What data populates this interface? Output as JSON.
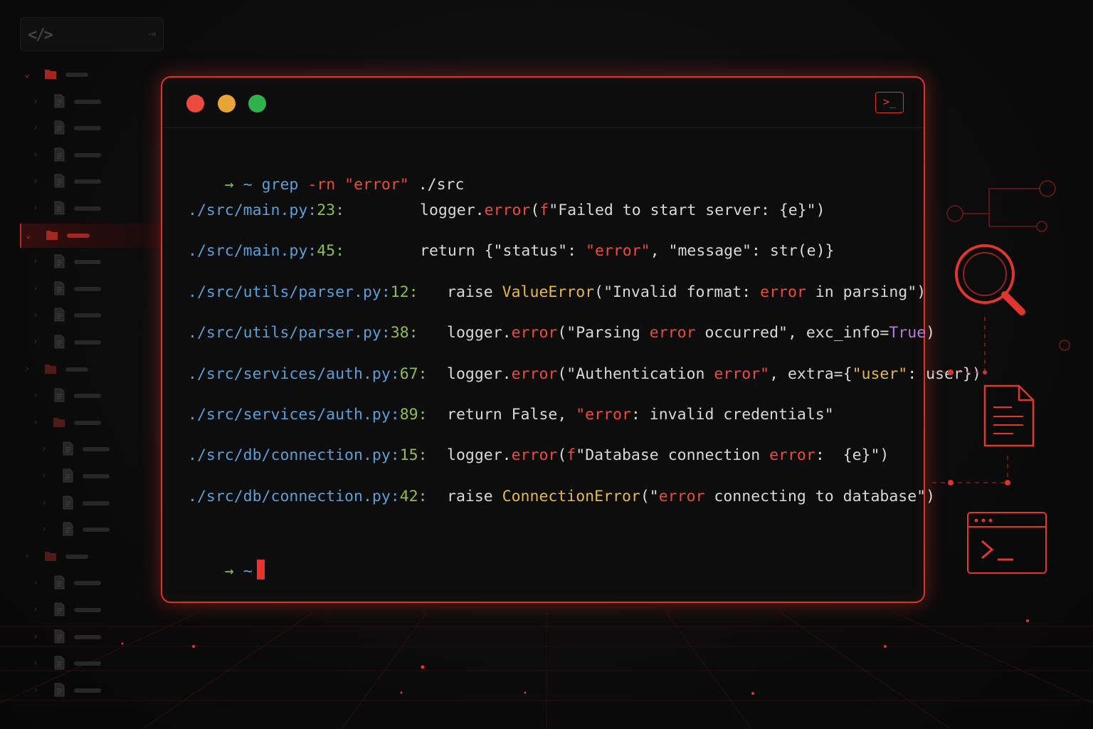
{
  "sidebar": {
    "header_icon": "code-icon",
    "collapse_icon": "collapse-icon",
    "rows": [
      {
        "type": "folder",
        "open": true,
        "indent": 0,
        "active": false
      },
      {
        "type": "file",
        "open": false,
        "indent": 1,
        "active": false
      },
      {
        "type": "file",
        "open": false,
        "indent": 1,
        "active": false
      },
      {
        "type": "file",
        "open": false,
        "indent": 1,
        "active": false
      },
      {
        "type": "file",
        "open": false,
        "indent": 1,
        "active": false
      },
      {
        "type": "file",
        "open": false,
        "indent": 1,
        "active": false
      },
      {
        "type": "folder",
        "open": true,
        "indent": 0,
        "active": true
      },
      {
        "type": "file",
        "open": false,
        "indent": 1,
        "active": false
      },
      {
        "type": "file",
        "open": false,
        "indent": 1,
        "active": false
      },
      {
        "type": "file",
        "open": false,
        "indent": 1,
        "active": false
      },
      {
        "type": "file",
        "open": false,
        "indent": 1,
        "active": false
      },
      {
        "type": "folder",
        "open": false,
        "indent": 0,
        "active": false
      },
      {
        "type": "file",
        "open": false,
        "indent": 1,
        "active": false
      },
      {
        "type": "folder",
        "open": false,
        "indent": 1,
        "active": false
      },
      {
        "type": "file",
        "open": false,
        "indent": 2,
        "active": false
      },
      {
        "type": "file",
        "open": false,
        "indent": 2,
        "active": false
      },
      {
        "type": "file",
        "open": false,
        "indent": 2,
        "active": false
      },
      {
        "type": "file",
        "open": false,
        "indent": 2,
        "active": false
      },
      {
        "type": "folder",
        "open": false,
        "indent": 0,
        "active": false
      },
      {
        "type": "file",
        "open": false,
        "indent": 1,
        "active": false
      },
      {
        "type": "file",
        "open": false,
        "indent": 1,
        "active": false
      },
      {
        "type": "file",
        "open": false,
        "indent": 1,
        "active": false
      },
      {
        "type": "file",
        "open": false,
        "indent": 1,
        "active": false
      },
      {
        "type": "file",
        "open": false,
        "indent": 1,
        "active": false
      }
    ]
  },
  "terminal": {
    "traffic_lights": {
      "close": "#ec4a3f",
      "minimize": "#e8a536",
      "maximize": "#2fb24a"
    },
    "corner_icon": "terminal-prompt-icon",
    "corner_icon_text": ">_",
    "prompt": {
      "arrow": "→",
      "tilde": "~"
    },
    "command": {
      "name": "grep",
      "flags": "-rn",
      "pattern": "\"error\"",
      "target": "./src"
    },
    "results": [
      {
        "file": "./src/main.py",
        "sep": ":",
        "line": "23",
        "colon": ":",
        "segments": [
          [
            "logger.",
            "w"
          ],
          [
            "error",
            "r"
          ],
          [
            "(",
            "w"
          ],
          [
            "f",
            "r"
          ],
          [
            "\"Failed to start server: {e}\")",
            "w"
          ]
        ]
      },
      {
        "file": "./src/main.py",
        "sep": ":",
        "line": "45",
        "colon": ":",
        "segments": [
          [
            "return {\"status\": ",
            "w"
          ],
          [
            "\"error\"",
            "r"
          ],
          [
            ", \"message\": str(e)}",
            "w"
          ]
        ]
      },
      {
        "file": "./src/utils/parser.py",
        "sep": ":",
        "line": "12",
        "colon": ":",
        "segments": [
          [
            "raise ",
            "w"
          ],
          [
            "ValueError",
            "y"
          ],
          [
            "(\"Invalid format: ",
            "w"
          ],
          [
            "error",
            "r"
          ],
          [
            " in parsing\")",
            "w"
          ]
        ]
      },
      {
        "file": "./src/utils/parser.py",
        "sep": ":",
        "line": "38",
        "colon": ":",
        "segments": [
          [
            "logger.",
            "w"
          ],
          [
            "error",
            "r"
          ],
          [
            "(\"Parsing ",
            "w"
          ],
          [
            "error",
            "r"
          ],
          [
            " occurred\", exc_info=",
            "w"
          ],
          [
            "True",
            "p"
          ],
          [
            ")",
            "w"
          ]
        ]
      },
      {
        "file": "./src/services/auth.py",
        "sep": ":",
        "line": "67",
        "colon": ":",
        "segments": [
          [
            "logger.",
            "w"
          ],
          [
            "error",
            "r"
          ],
          [
            "(\"Authentication ",
            "w"
          ],
          [
            "error\"",
            "r"
          ],
          [
            ", extra={",
            "w"
          ],
          [
            "\"user\"",
            "y"
          ],
          [
            ": user})",
            "w"
          ]
        ]
      },
      {
        "file": "./src/services/auth.py",
        "sep": ":",
        "line": "89",
        "colon": ":",
        "segments": [
          [
            "return False, ",
            "w"
          ],
          [
            "\"error",
            "r"
          ],
          [
            ": invalid credentials\"",
            "w"
          ]
        ]
      },
      {
        "file": "./src/db/connection.py",
        "sep": ":",
        "line": "15",
        "colon": ":",
        "segments": [
          [
            "logger.",
            "w"
          ],
          [
            "error",
            "r"
          ],
          [
            "(",
            "w"
          ],
          [
            "f",
            "r"
          ],
          [
            "\"Database connection ",
            "w"
          ],
          [
            "error",
            "r"
          ],
          [
            ":  {e}\")",
            "w"
          ]
        ]
      },
      {
        "file": "./src/db/connection.py",
        "sep": ":",
        "line": "42",
        "colon": ":",
        "segments": [
          [
            "raise ",
            "w"
          ],
          [
            "ConnectionError",
            "y"
          ],
          [
            "(\"",
            "w"
          ],
          [
            "error",
            "r"
          ],
          [
            " connecting to database\")",
            "w"
          ]
        ]
      }
    ]
  },
  "decor_icons": [
    "circuit-icon",
    "magnifier-icon",
    "document-icon",
    "terminal-window-icon"
  ]
}
